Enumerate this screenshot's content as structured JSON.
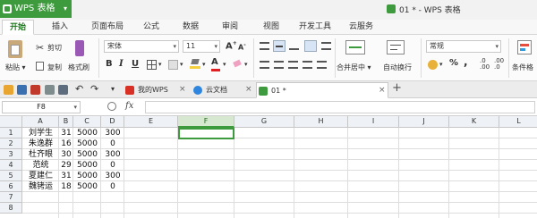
{
  "app": {
    "name": "WPS 表格",
    "doc_title": "01 * - WPS 表格"
  },
  "menu": [
    "开始",
    "插入",
    "页面布局",
    "公式",
    "数据",
    "审阅",
    "视图",
    "开发工具",
    "云服务"
  ],
  "ribbon": {
    "paste": "粘贴",
    "cut": "剪切",
    "copy": "复制",
    "format_painter": "格式刷",
    "font_name": "宋体",
    "font_size": "11",
    "grow_font": "A",
    "shrink_font": "A",
    "bold": "B",
    "italic": "I",
    "underline": "U",
    "merge_center": "合并居中",
    "wrap_text": "自动换行",
    "number_format": "常规",
    "percent": "%",
    "comma": ",",
    "conditional_format": "条件格"
  },
  "tabs": [
    {
      "label": "我的WPS"
    },
    {
      "label": "云文档"
    },
    {
      "label": "01 *"
    }
  ],
  "formula_bar": {
    "name_box": "F8",
    "fx": "fx",
    "content": ""
  },
  "sheet": {
    "columns": [
      "A",
      "B",
      "C",
      "D",
      "E",
      "F",
      "G",
      "H",
      "I",
      "J",
      "K",
      "L"
    ],
    "selected_column": "F",
    "row_numbers": [
      "1",
      "2",
      "3",
      "4",
      "5",
      "6",
      "7",
      "8"
    ],
    "rows": [
      [
        "刘学生",
        "31",
        "5000",
        "300"
      ],
      [
        "朱逸群",
        "16",
        "5000",
        "0"
      ],
      [
        "杜齐眼",
        "30",
        "5000",
        "300"
      ],
      [
        "范统",
        "29",
        "5000",
        "0"
      ],
      [
        "夏建仁",
        "31",
        "5000",
        "300"
      ],
      [
        "魏铐运",
        "18",
        "5000",
        "0"
      ]
    ]
  },
  "colors": {
    "accent": "#3d9a3d",
    "header_bg": "#eef1f5"
  }
}
